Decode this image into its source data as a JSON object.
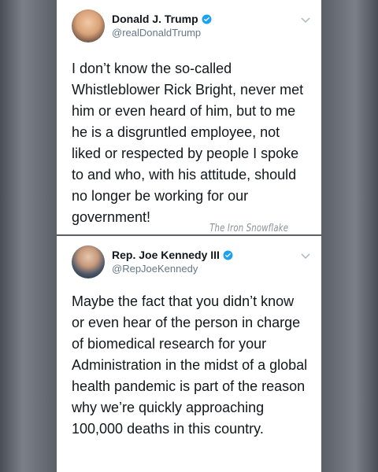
{
  "tweets": [
    {
      "display_name": "Donald J. Trump",
      "handle": "@realDonaldTrump",
      "verified": true,
      "text": "I don’t know the so-called Whistleblower Rick Bright, never met him or even heard of him, but to me he is a disgruntled employee, not liked or respected by people I spoke to and who, with his attitude, should no longer be working for our government!"
    },
    {
      "display_name": "Rep. Joe Kennedy III",
      "handle": "@RepJoeKennedy",
      "verified": true,
      "text": "Maybe the fact that you didn’t know or even hear of the person in charge of biomedical research for your Administration in the midst of a global health pandemic is part of the reason why we’re quickly approaching 100,000 deaths in this country."
    }
  ],
  "watermark": "The Iron Snowflake",
  "colors": {
    "verified": "#1da1f2",
    "text": "#14171a",
    "handle": "#657786"
  }
}
